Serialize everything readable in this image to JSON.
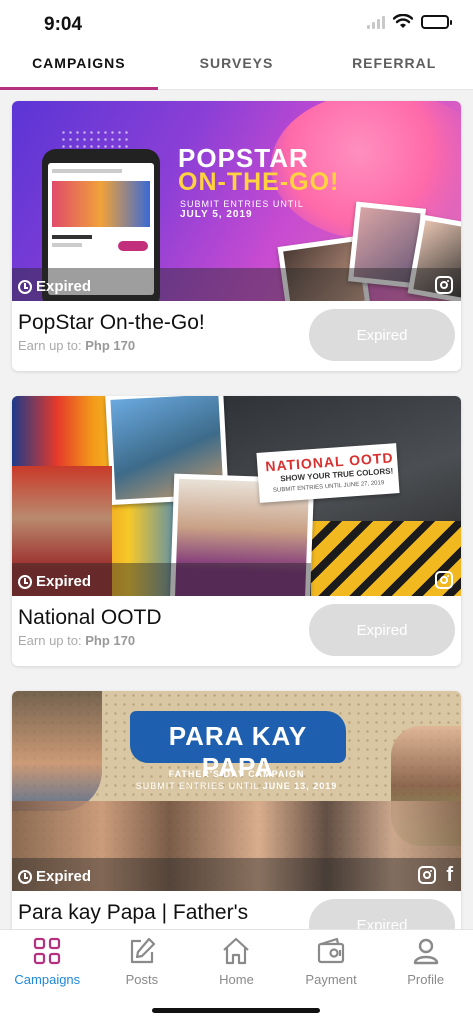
{
  "status_bar": {
    "time": "9:04"
  },
  "tabs": [
    {
      "label": "CAMPAIGNS",
      "active": true
    },
    {
      "label": "SURVEYS",
      "active": false
    },
    {
      "label": "REFERRAL",
      "active": false
    }
  ],
  "campaigns": [
    {
      "title": "PopStar On-the-Go!",
      "earn_prefix": "Earn up to: ",
      "earn_amount": "Php 170",
      "status": "Expired",
      "button_label": "Expired",
      "banner": {
        "headline_1": "POPSTAR",
        "headline_2": "ON-THE-GO!",
        "sub_1": "SUBMIT ENTRIES UNTIL",
        "sub_2": "JULY 5, 2019"
      },
      "social": [
        "instagram-icon"
      ]
    },
    {
      "title": "National OOTD",
      "earn_prefix": "Earn up to: ",
      "earn_amount": "Php 170",
      "status": "Expired",
      "button_label": "Expired",
      "banner": {
        "headline_1": "NATIONAL OOTD",
        "headline_2": "SHOW YOUR TRUE COLORS!",
        "sub_1": "SUBMIT ENTRIES UNTIL JUNE 27, 2019"
      },
      "social": [
        "instagram-icon"
      ]
    },
    {
      "title": "Para kay Papa | Father's",
      "status": "Expired",
      "button_label": "Expired",
      "banner": {
        "headline_1": "PARA KAY PAPA",
        "sub_1": "FATHER'S DAY CAMPAIGN",
        "sub_2_prefix": "SUBMIT ENTRIES UNTIL ",
        "sub_2_date": "JUNE 13, 2019"
      },
      "social": [
        "instagram-icon",
        "facebook-icon"
      ]
    }
  ],
  "bottom_nav": [
    {
      "label": "Campaigns",
      "icon": "grid-icon",
      "active": true
    },
    {
      "label": "Posts",
      "icon": "edit-icon",
      "active": false
    },
    {
      "label": "Home",
      "icon": "home-icon",
      "active": false
    },
    {
      "label": "Payment",
      "icon": "wallet-icon",
      "active": false
    },
    {
      "label": "Profile",
      "icon": "user-icon",
      "active": false
    }
  ],
  "colors": {
    "accent": "#b5307f",
    "active_nav": "#1e88d8",
    "button_disabled": "#dcdcdc"
  }
}
